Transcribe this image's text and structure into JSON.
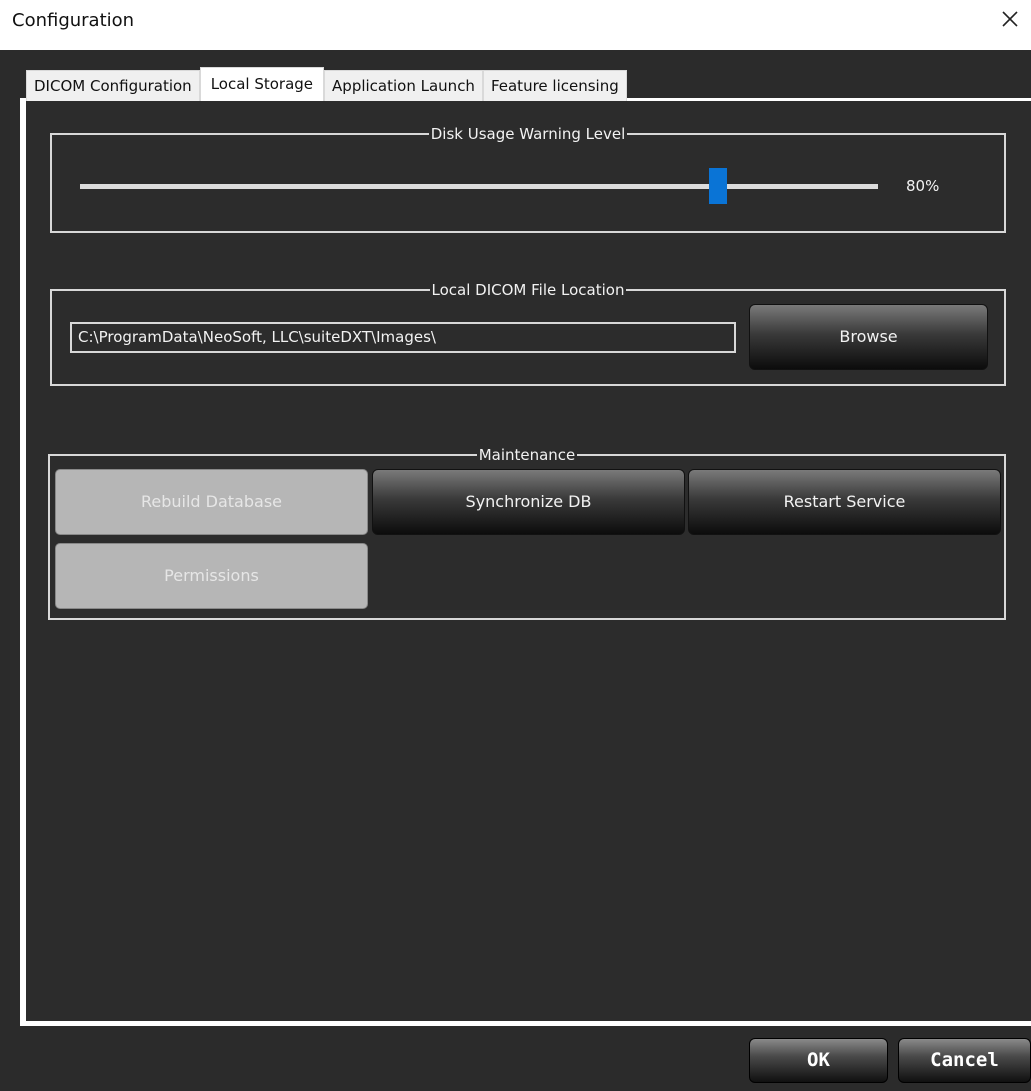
{
  "window": {
    "title": "Configuration",
    "close_icon": "close-icon"
  },
  "tabs": [
    {
      "label": "DICOM Configuration",
      "active": false
    },
    {
      "label": "Local Storage",
      "active": true
    },
    {
      "label": "Application Launch",
      "active": false
    },
    {
      "label": "Feature licensing",
      "active": false
    }
  ],
  "disk_usage": {
    "title": "Disk Usage Warning Level",
    "value": 0.8,
    "value_label": "80%"
  },
  "file_location": {
    "title": "Local DICOM File Location",
    "path": "C:\\ProgramData\\NeoSoft, LLC\\suiteDXT\\Images\\",
    "browse_label": "Browse"
  },
  "maintenance": {
    "title": "Maintenance",
    "rebuild_label": "Rebuild Database",
    "sync_label": "Synchronize DB",
    "restart_label": "Restart Service",
    "permissions_label": "Permissions"
  },
  "footer": {
    "ok_label": "OK",
    "cancel_label": "Cancel"
  },
  "colors": {
    "slider_thumb": "#0a74d6",
    "panel_background": "#2c2c2c"
  }
}
